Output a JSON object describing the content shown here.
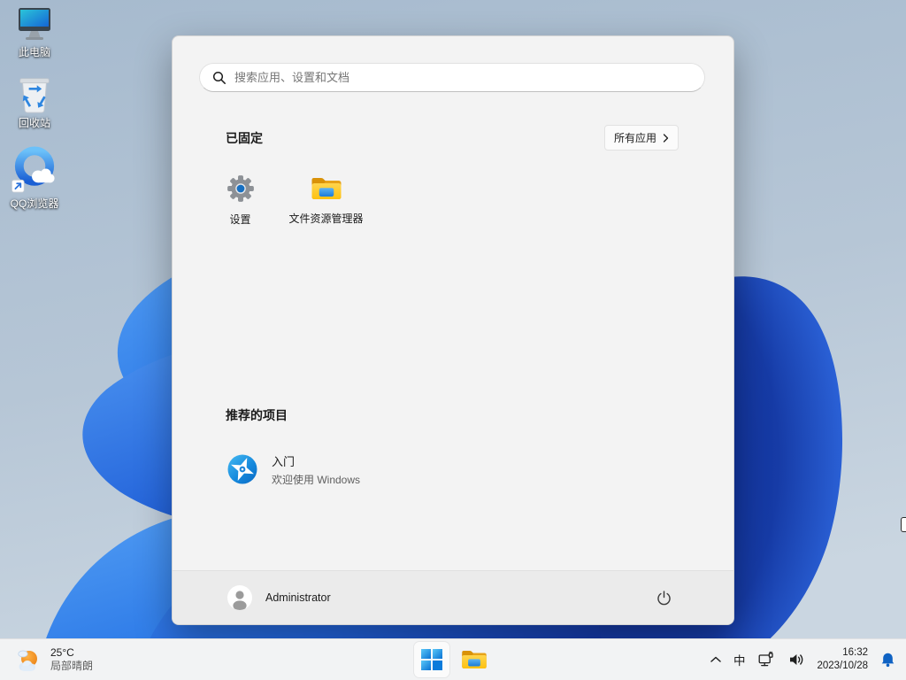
{
  "desktop": {
    "icons": [
      {
        "label": "此电脑"
      },
      {
        "label": "回收站"
      },
      {
        "label": "QQ浏览器"
      }
    ]
  },
  "start_menu": {
    "search_placeholder": "搜索应用、设置和文档",
    "pinned_section": {
      "title": "已固定",
      "all_apps_label": "所有应用"
    },
    "pinned_items": [
      {
        "label": "设置"
      },
      {
        "label": "文件资源管理器"
      }
    ],
    "recommended_section": {
      "title": "推荐的项目"
    },
    "recommended_items": [
      {
        "title": "入门",
        "subtitle": "欢迎使用 Windows"
      }
    ],
    "user_name": "Administrator"
  },
  "taskbar": {
    "weather": {
      "temperature": "25°C",
      "condition": "局部晴朗"
    },
    "tray": {
      "ime_indicator": "中",
      "time": "16:32",
      "date": "2023/10/28"
    }
  },
  "colors": {
    "accent_blue": "#0F62C3",
    "menu_bg": "#F3F3F3",
    "taskbar_bg": "#F2F3F4",
    "bell_blue": "#0F62C3"
  }
}
